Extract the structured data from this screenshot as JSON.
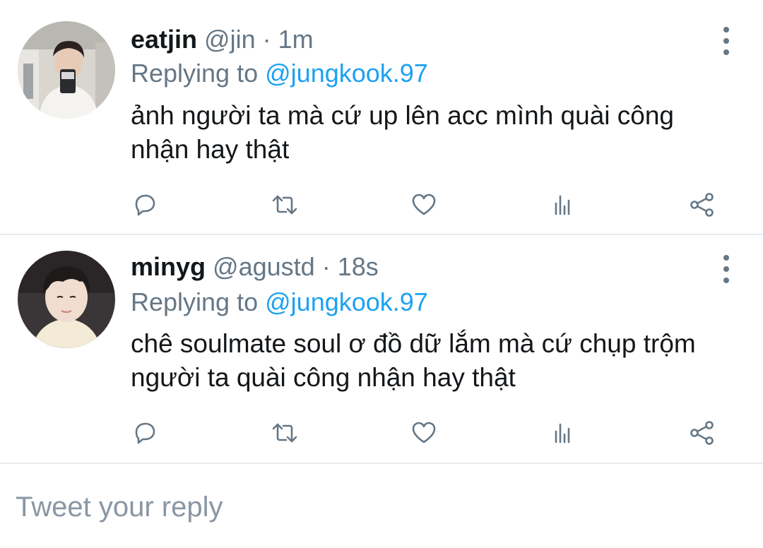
{
  "tweets": [
    {
      "name": "eatjin",
      "handle": "@jin",
      "separator": "·",
      "time": "1m",
      "replying_prefix": "Replying to",
      "replying_to": "@jungkook.97",
      "text": "ảnh người ta mà cứ up lên acc mình quài công nhận hay thật"
    },
    {
      "name": "minyg",
      "handle": "@agustd",
      "separator": "·",
      "time": "18s",
      "replying_prefix": "Replying to",
      "replying_to": "@jungkook.97",
      "text": "chê soulmate soul ơ đồ dữ lắm mà cứ chụp trộm người ta quài công nhận hay thật"
    }
  ],
  "compose": {
    "placeholder": "Tweet your reply"
  },
  "colors": {
    "text": "#14171a",
    "secondary": "#657786",
    "link": "#1da1f2",
    "divider": "#e6ecf0"
  },
  "icons": [
    "reply-icon",
    "retweet-icon",
    "like-icon",
    "analytics-icon",
    "share-icon",
    "more-options-icon"
  ]
}
